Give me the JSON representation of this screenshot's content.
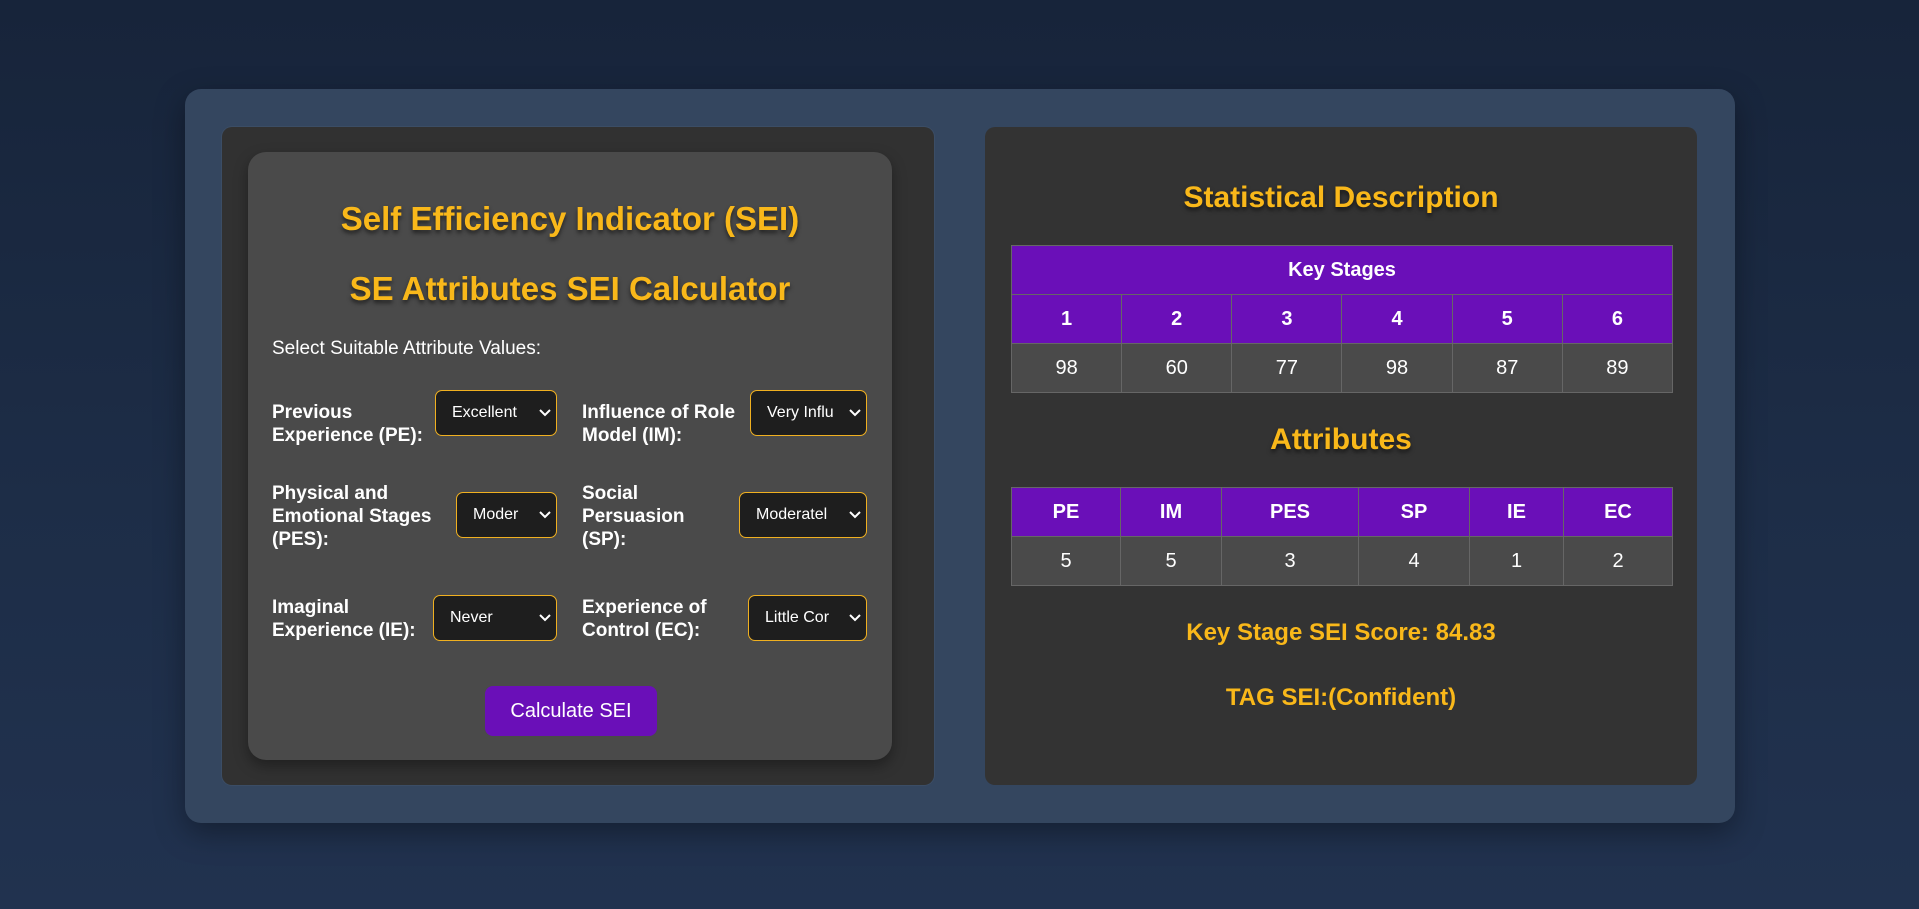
{
  "calculator": {
    "title": "Self Efficiency Indicator (SEI)",
    "subtitle": "SE Attributes SEI Calculator",
    "prompt": "Select Suitable Attribute Values:",
    "fields": {
      "pe": {
        "label": "Previous Experience (PE):",
        "value": "Excellent"
      },
      "im": {
        "label": "Influence of Role Model (IM):",
        "value": "Very Influ"
      },
      "pes": {
        "label": "Physical and Emotional Stages (PES):",
        "value": "Moder"
      },
      "sp": {
        "label": "Social Persuasion (SP):",
        "value": "Moderatel"
      },
      "ie": {
        "label": "Imaginal Experience (IE):",
        "value": "Never"
      },
      "ec": {
        "label": "Experience of Control (EC):",
        "value": "Little Cor"
      }
    },
    "button_label": "Calculate SEI"
  },
  "stats": {
    "title": "Statistical Description",
    "key_stages_header": "Key Stages",
    "stage_headers": [
      "1",
      "2",
      "3",
      "4",
      "5",
      "6"
    ],
    "stage_values": [
      "98",
      "60",
      "77",
      "98",
      "87",
      "89"
    ],
    "attributes_title": "Attributes",
    "attr_headers": [
      "PE",
      "IM",
      "PES",
      "SP",
      "IE",
      "EC"
    ],
    "attr_values": [
      "5",
      "5",
      "3",
      "4",
      "1",
      "2"
    ],
    "score_text": "Key Stage SEI Score: 84.83",
    "tag_text": "TAG SEI:(Confident)"
  },
  "colors": {
    "accent": "#f9b81a",
    "purple": "#6a0fb8"
  }
}
